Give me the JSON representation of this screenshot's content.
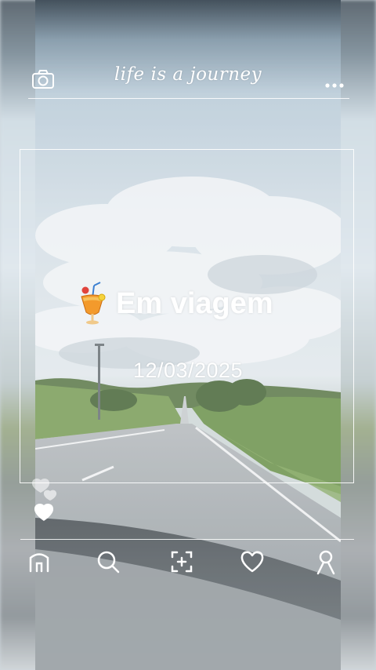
{
  "header": {
    "title": "life is a journey"
  },
  "story": {
    "headline": "Em viagem",
    "date": "12/03/2025"
  },
  "icons": {
    "camera": "camera-icon",
    "more": "more-dots-icon",
    "drink": "tropical-drink-icon",
    "hearts": "hearts-icon",
    "home": "home-icon",
    "search": "search-icon",
    "add": "add-photo-icon",
    "like": "heart-outline-icon",
    "profile": "profile-icon"
  },
  "colors": {
    "overlay_text": "#ffffff",
    "sky": "#dbe5ec",
    "grass": "#7fa35a",
    "road": "#9ea6ab"
  }
}
